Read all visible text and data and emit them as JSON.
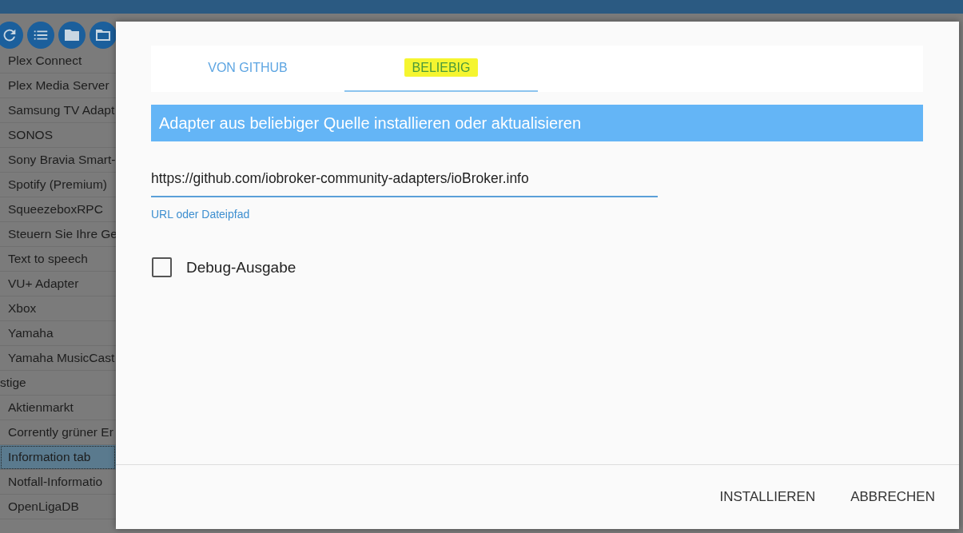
{
  "toolbar": {
    "buttons": [
      {
        "kind": "refresh"
      },
      {
        "kind": "list"
      },
      {
        "kind": "folder"
      },
      {
        "kind": "folder-outline"
      }
    ]
  },
  "adapter_list": [
    {
      "label": "Plex Connect",
      "kind": "item",
      "selected": false
    },
    {
      "label": "Plex Media Server",
      "kind": "item",
      "selected": false
    },
    {
      "label": "Samsung TV Adapt",
      "kind": "item",
      "selected": false
    },
    {
      "label": "SONOS",
      "kind": "item",
      "selected": false
    },
    {
      "label": "Sony Bravia Smart-",
      "kind": "item",
      "selected": false
    },
    {
      "label": "Spotify (Premium)",
      "kind": "item",
      "selected": false
    },
    {
      "label": "SqueezeboxRPC",
      "kind": "item",
      "selected": false
    },
    {
      "label": "Steuern Sie Ihre Ge",
      "kind": "item",
      "selected": false
    },
    {
      "label": "Text to speech",
      "kind": "item",
      "selected": false
    },
    {
      "label": "VU+ Adapter",
      "kind": "item",
      "selected": false
    },
    {
      "label": "Xbox",
      "kind": "item",
      "selected": false
    },
    {
      "label": "Yamaha",
      "kind": "item",
      "selected": false
    },
    {
      "label": "Yamaha MusicCast",
      "kind": "item",
      "selected": false
    },
    {
      "label": "stige",
      "kind": "group",
      "selected": false
    },
    {
      "label": "Aktienmarkt",
      "kind": "item",
      "selected": false
    },
    {
      "label": "Corrently grüner Er",
      "kind": "item",
      "selected": false
    },
    {
      "label": "Information tab",
      "kind": "item",
      "selected": true
    },
    {
      "label": "Notfall-Informatio",
      "kind": "item",
      "selected": false
    },
    {
      "label": "OpenLigaDB",
      "kind": "item",
      "selected": false
    }
  ],
  "dialog": {
    "tabs": [
      {
        "label": "VON GITHUB",
        "selected": false,
        "highlighted": false
      },
      {
        "label": "BELIEBIG",
        "selected": true,
        "highlighted": true
      }
    ],
    "header": "Adapter aus beliebiger Quelle installieren oder aktualisieren",
    "url_field": {
      "value": "https://github.com/iobroker-community-adapters/ioBroker.info",
      "helper": "URL oder Dateipfad"
    },
    "debug_checkbox": {
      "label": "Debug-Ausgabe",
      "checked": false
    },
    "buttons": [
      "INSTALLIEREN",
      "ABBRECHEN"
    ]
  }
}
